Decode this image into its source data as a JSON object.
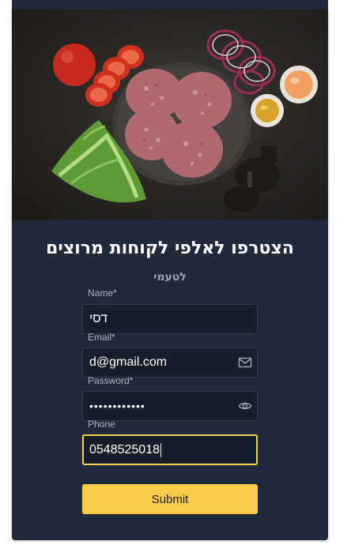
{
  "page": {
    "title": "הצטרפו לאלפי לקוחות מרוצים",
    "subtitle": "לטעמי"
  },
  "form": {
    "name": {
      "label": "Name*",
      "value": "דסי"
    },
    "email": {
      "label": "Email*",
      "value": "d@gmail.com",
      "icon": "mail-icon"
    },
    "password": {
      "label": "Password*",
      "value": "••••••••••••",
      "icon": "eye-icon"
    },
    "phone": {
      "label": "Phone",
      "value": "0548525018"
    },
    "submit_label": "Submit"
  },
  "colors": {
    "card_background": "#1f2a3d",
    "input_background": "#161e2c",
    "accent": "#f8cc48"
  }
}
